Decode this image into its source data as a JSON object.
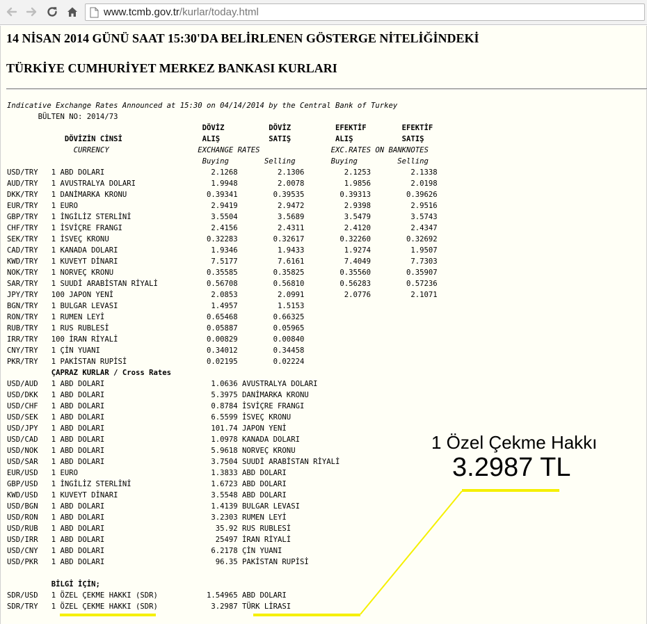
{
  "browser": {
    "url_host": "www.tcmb.gov.tr",
    "url_path": "/kurlar/today.html",
    "icons": [
      "back-arrow-icon",
      "forward-arrow-icon",
      "reload-icon",
      "home-icon",
      "page-icon"
    ]
  },
  "page": {
    "title_line1": "14 NİSAN 2014 GÜNÜ SAAT 15:30'DA BELİRLENEN GÖSTERGE NİTELİĞİNDEKİ",
    "title_line2": "TÜRKİYE CUMHURİYET MERKEZ BANKASI KURLARI",
    "subtitle": "Indicative Exchange Rates Announced at 15:30 on 04/14/2014 by the Central Bank of Turkey",
    "bulletin": "       BÜLTEN NO: 2014/73",
    "header_row1": "                                            DÖVİZ          DÖVİZ          EFEKTİF        EFEKTİF",
    "header_row2": "             DÖVİZİN CİNSİ                  ALIŞ           SATIŞ          ALIŞ           SATIŞ",
    "header_row3": "               CURRENCY                    EXCHANGE RATES                EXC.RATES ON BANKNOTES",
    "header_row4": "                                            Buying        Selling        Buying         Selling",
    "rates": [
      {
        "code": "USD/TRY",
        "unit": "1",
        "name": "ABD DOLARI",
        "fx_buy": "2.1268",
        "fx_sell": "2.1306",
        "bn_buy": "2.1253",
        "bn_sell": "2.1338"
      },
      {
        "code": "AUD/TRY",
        "unit": "1",
        "name": "AVUSTRALYA DOLARI",
        "fx_buy": "1.9948",
        "fx_sell": "2.0078",
        "bn_buy": "1.9856",
        "bn_sell": "2.0198"
      },
      {
        "code": "DKK/TRY",
        "unit": "1",
        "name": "DANİMARKA KRONU",
        "fx_buy": "0.39341",
        "fx_sell": "0.39535",
        "bn_buy": "0.39313",
        "bn_sell": "0.39626"
      },
      {
        "code": "EUR/TRY",
        "unit": "1",
        "name": "EURO",
        "fx_buy": "2.9419",
        "fx_sell": "2.9472",
        "bn_buy": "2.9398",
        "bn_sell": "2.9516"
      },
      {
        "code": "GBP/TRY",
        "unit": "1",
        "name": "İNGİLİZ STERLİNİ",
        "fx_buy": "3.5504",
        "fx_sell": "3.5689",
        "bn_buy": "3.5479",
        "bn_sell": "3.5743"
      },
      {
        "code": "CHF/TRY",
        "unit": "1",
        "name": "İSVİÇRE FRANGI",
        "fx_buy": "2.4156",
        "fx_sell": "2.4311",
        "bn_buy": "2.4120",
        "bn_sell": "2.4347"
      },
      {
        "code": "SEK/TRY",
        "unit": "1",
        "name": "İSVEÇ KRONU",
        "fx_buy": "0.32283",
        "fx_sell": "0.32617",
        "bn_buy": "0.32260",
        "bn_sell": "0.32692"
      },
      {
        "code": "CAD/TRY",
        "unit": "1",
        "name": "KANADA DOLARI",
        "fx_buy": "1.9346",
        "fx_sell": "1.9433",
        "bn_buy": "1.9274",
        "bn_sell": "1.9507"
      },
      {
        "code": "KWD/TRY",
        "unit": "1",
        "name": "KUVEYT DİNARI",
        "fx_buy": "7.5177",
        "fx_sell": "7.6161",
        "bn_buy": "7.4049",
        "bn_sell": "7.7303"
      },
      {
        "code": "NOK/TRY",
        "unit": "1",
        "name": "NORVEÇ KRONU",
        "fx_buy": "0.35585",
        "fx_sell": "0.35825",
        "bn_buy": "0.35560",
        "bn_sell": "0.35907"
      },
      {
        "code": "SAR/TRY",
        "unit": "1",
        "name": "SUUDİ ARABİSTAN RİYALİ",
        "fx_buy": "0.56708",
        "fx_sell": "0.56810",
        "bn_buy": "0.56283",
        "bn_sell": "0.57236"
      },
      {
        "code": "JPY/TRY",
        "unit": "100",
        "name": "JAPON YENİ",
        "fx_buy": "2.0853",
        "fx_sell": "2.0991",
        "bn_buy": "2.0776",
        "bn_sell": "2.1071"
      },
      {
        "code": "BGN/TRY",
        "unit": "1",
        "name": "BULGAR LEVASI",
        "fx_buy": "1.4957",
        "fx_sell": "1.5153",
        "bn_buy": "",
        "bn_sell": ""
      },
      {
        "code": "RON/TRY",
        "unit": "1",
        "name": "RUMEN LEYİ",
        "fx_buy": "0.65468",
        "fx_sell": "0.66325",
        "bn_buy": "",
        "bn_sell": ""
      },
      {
        "code": "RUB/TRY",
        "unit": "1",
        "name": "RUS RUBLESİ",
        "fx_buy": "0.05887",
        "fx_sell": "0.05965",
        "bn_buy": "",
        "bn_sell": ""
      },
      {
        "code": "IRR/TRY",
        "unit": "100",
        "name": "İRAN RİYALİ",
        "fx_buy": "0.00829",
        "fx_sell": "0.00840",
        "bn_buy": "",
        "bn_sell": ""
      },
      {
        "code": "CNY/TRY",
        "unit": "1",
        "name": "ÇİN YUANI",
        "fx_buy": "0.34012",
        "fx_sell": "0.34458",
        "bn_buy": "",
        "bn_sell": ""
      },
      {
        "code": "PKR/TRY",
        "unit": "1",
        "name": "PAKİSTAN RUPİSİ",
        "fx_buy": "0.02195",
        "fx_sell": "0.02224",
        "bn_buy": "",
        "bn_sell": ""
      }
    ],
    "cross_header": "          ÇAPRAZ KURLAR / Cross Rates",
    "cross_rates": [
      {
        "code": "USD/AUD",
        "unit": "1",
        "name": "ABD DOLARI",
        "rate": "1.0636",
        "target": "AVUSTRALYA DOLARI"
      },
      {
        "code": "USD/DKK",
        "unit": "1",
        "name": "ABD DOLARI",
        "rate": "5.3975",
        "target": "DANİMARKA KRONU"
      },
      {
        "code": "USD/CHF",
        "unit": "1",
        "name": "ABD DOLARI",
        "rate": "0.8784",
        "target": "İSVİÇRE FRANGI"
      },
      {
        "code": "USD/SEK",
        "unit": "1",
        "name": "ABD DOLARI",
        "rate": "6.5599",
        "target": "İSVEÇ KRONU"
      },
      {
        "code": "USD/JPY",
        "unit": "1",
        "name": "ABD DOLARI",
        "rate": "101.74",
        "target": "JAPON YENİ"
      },
      {
        "code": "USD/CAD",
        "unit": "1",
        "name": "ABD DOLARI",
        "rate": "1.0978",
        "target": "KANADA DOLARI"
      },
      {
        "code": "USD/NOK",
        "unit": "1",
        "name": "ABD DOLARI",
        "rate": "5.9618",
        "target": "NORVEÇ KRONU"
      },
      {
        "code": "USD/SAR",
        "unit": "1",
        "name": "ABD DOLARI",
        "rate": "3.7504",
        "target": "SUUDİ ARABİSTAN RİYALİ"
      },
      {
        "code": "EUR/USD",
        "unit": "1",
        "name": "EURO",
        "rate": "1.3833",
        "target": "ABD DOLARI"
      },
      {
        "code": "GBP/USD",
        "unit": "1",
        "name": "İNGİLİZ STERLİNİ",
        "rate": "1.6723",
        "target": "ABD DOLARI"
      },
      {
        "code": "KWD/USD",
        "unit": "1",
        "name": "KUVEYT DİNARI",
        "rate": "3.5548",
        "target": "ABD DOLARI"
      },
      {
        "code": "USD/BGN",
        "unit": "1",
        "name": "ABD DOLARI",
        "rate": "1.4139",
        "target": "BULGAR LEVASI"
      },
      {
        "code": "USD/RON",
        "unit": "1",
        "name": "ABD DOLARI",
        "rate": "3.2303",
        "target": "RUMEN LEYİ"
      },
      {
        "code": "USD/RUB",
        "unit": "1",
        "name": "ABD DOLARI",
        "rate": "35.92",
        "target": "RUS RUBLESİ"
      },
      {
        "code": "USD/IRR",
        "unit": "1",
        "name": "ABD DOLARI",
        "rate": "25497",
        "target": "İRAN RİYALİ"
      },
      {
        "code": "USD/CNY",
        "unit": "1",
        "name": "ABD DOLARI",
        "rate": "6.2178",
        "target": "ÇİN YUANI"
      },
      {
        "code": "USD/PKR",
        "unit": "1",
        "name": "ABD DOLARI",
        "rate": "96.35",
        "target": "PAKİSTAN RUPİSİ"
      }
    ],
    "info_header": "          BİLGİ İÇİN;",
    "sdr_rates": [
      {
        "code": "SDR/USD",
        "unit": "1",
        "name": "ÖZEL ÇEKME HAKKI (SDR)",
        "rate": "1.54965",
        "target": "ABD DOLARI"
      },
      {
        "code": "SDR/TRY",
        "unit": "1",
        "name": "ÖZEL ÇEKME HAKKI (SDR)",
        "rate": "3.2987",
        "target": "TÜRK LİRASI"
      }
    ]
  },
  "annotation": {
    "line1": "1 Özel Çekme Hakkı",
    "line2": "3.2987 TL",
    "highlight_color": "#f5f000"
  }
}
